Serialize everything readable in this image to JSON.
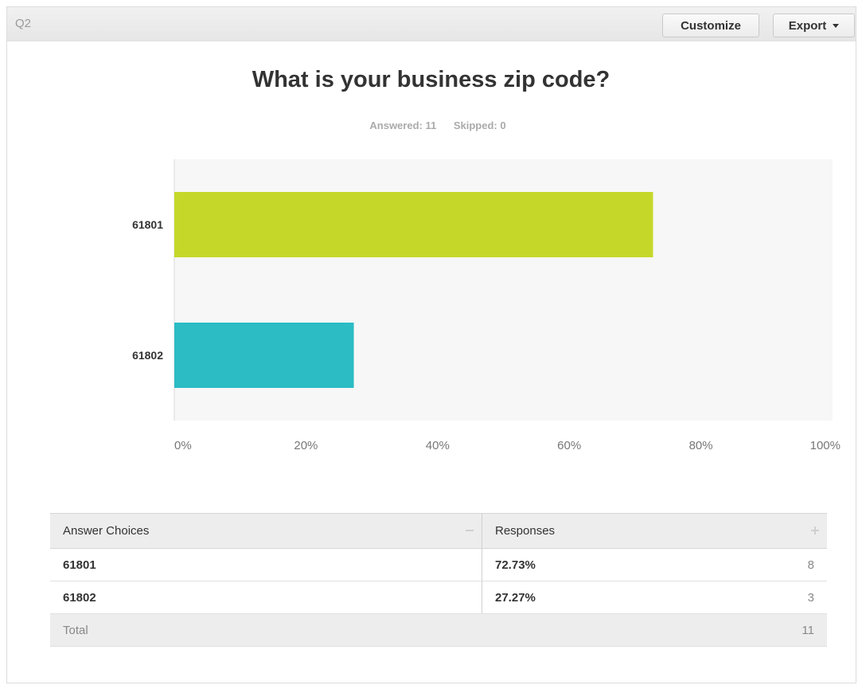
{
  "header": {
    "question_number": "Q2",
    "customize_label": "Customize",
    "export_label": "Export"
  },
  "question": {
    "title": "What is your business zip code?",
    "answered_text": "Answered: 11",
    "skipped_text": "Skipped: 0"
  },
  "chart_data": {
    "type": "bar",
    "orientation": "horizontal",
    "categories": [
      "61801",
      "61802"
    ],
    "values": [
      72.73,
      27.27
    ],
    "colors": [
      "#c5d82a",
      "#2bbcc4"
    ],
    "xlim": [
      0,
      100
    ],
    "x_ticks": [
      "0%",
      "20%",
      "40%",
      "60%",
      "80%",
      "100%"
    ]
  },
  "table": {
    "headers": {
      "choice": "Answer Choices",
      "responses": "Responses"
    },
    "rows": [
      {
        "choice": "61801",
        "percent": "72.73%",
        "count": "8"
      },
      {
        "choice": "61802",
        "percent": "27.27%",
        "count": "3"
      }
    ],
    "total": {
      "label": "Total",
      "count": "11"
    }
  }
}
